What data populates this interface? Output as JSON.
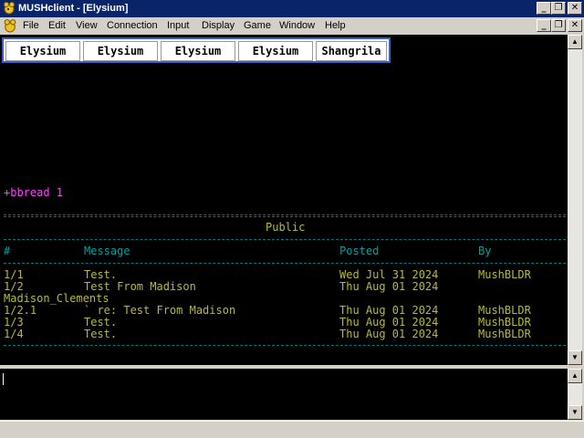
{
  "window": {
    "title": "MUSHclient - [Elysium]"
  },
  "menu": [
    "File",
    "Edit",
    "View",
    "Connection",
    "Input",
    "Display",
    "Game",
    "Window",
    "Help"
  ],
  "caption_buttons": {
    "minimize": "_",
    "restore": "❐",
    "close": "✕"
  },
  "tabs": [
    "Elysium",
    "Elysium",
    "Elysium",
    "Elysium",
    "Shangrila"
  ],
  "output": {
    "command": "+bbread 1",
    "board_title": "Public",
    "headers": {
      "num": "#",
      "message": "Message",
      "posted": "Posted",
      "by": "By"
    },
    "rows": [
      {
        "num": "1/1",
        "message": "Test.",
        "posted": "Wed Jul 31 2024",
        "by": "MushBLDR"
      },
      {
        "num": "1/2",
        "message": "Test From Madison",
        "posted": "Thu Aug 01 2024",
        "by": ""
      },
      {
        "num": "Madison_Clements",
        "message": "",
        "posted": "",
        "by": ""
      },
      {
        "num": "1/2.1",
        "message": "` re: Test From Madison",
        "posted": "Thu Aug 01 2024",
        "by": "MushBLDR"
      },
      {
        "num": "1/3",
        "message": "Test.",
        "posted": "Thu Aug 01 2024",
        "by": "MushBLDR"
      },
      {
        "num": "1/4",
        "message": "Test.",
        "posted": "Thu Aug 01 2024",
        "by": "MushBLDR"
      }
    ]
  },
  "colors": {
    "titlebar": "#0a246a",
    "command": "#ff40ff",
    "text": "#b8b840",
    "header": "#00a0a0",
    "tab_border": "#3a5fcd"
  }
}
